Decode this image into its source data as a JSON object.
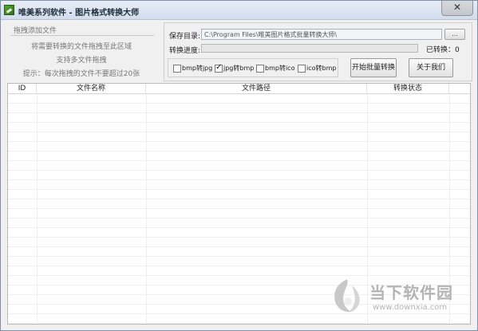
{
  "window": {
    "title": "唯美系列软件 - 图片格式转换大师",
    "close_label": "✕"
  },
  "drop_panel": {
    "title": "拖拽添加文件",
    "lines": [
      "将需要转换的文件拖拽至此区域",
      "支持多文件拖拽",
      "提示：每次拖拽的文件不要超过20张"
    ]
  },
  "settings": {
    "save_dir_label": "保存目录:",
    "save_dir_value": "C:\\Program Files\\唯美图片格式批量转换大师\\",
    "browse_label": "...",
    "progress_label": "转换进度:",
    "progress_fraction": 0,
    "converted_label": "已转换：",
    "converted_count": "0"
  },
  "formats": [
    {
      "label": "bmp转jpg",
      "checked": false
    },
    {
      "label": "jpg转bmp",
      "checked": true
    },
    {
      "label": "bmp转ico",
      "checked": false
    },
    {
      "label": "ico转bmp",
      "checked": false
    }
  ],
  "buttons": {
    "start": "开始批量转换",
    "about": "关于我们"
  },
  "table": {
    "columns": [
      "ID",
      "文件名称",
      "文件路径",
      "转换状态"
    ],
    "rows": []
  },
  "watermark": {
    "text": "当下软件园",
    "url": "www.downxia.com"
  }
}
